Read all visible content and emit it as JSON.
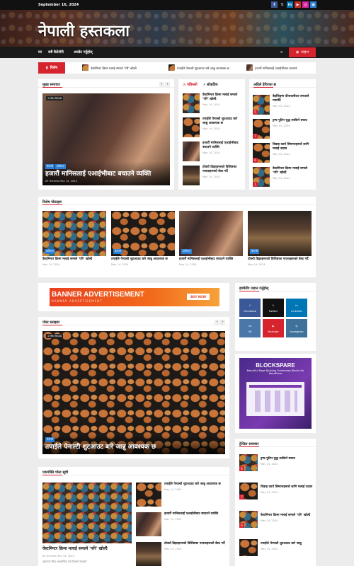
{
  "topbar": {
    "date": "September 16, 2024",
    "social": [
      "f",
      "𝕏",
      "in",
      "▶",
      "◎",
      "▣"
    ]
  },
  "site": {
    "title": "नेपाली हस्तकला"
  },
  "nav": {
    "items": [
      "घर",
      "सबै कैटेगोरी",
      "अपडेट गर्नुहोस्"
    ],
    "live": "लाइभ"
  },
  "ticker": {
    "label": "विशेष",
    "items": [
      "वेस्टमिन्टर क्रिमा मलाई समाले 'परि' खोल्दै",
      "तपाईले पेनाल्टी शुटआउट बारे जान्नु आवश्यक छ",
      "हजारौं मानिसलाई एआईभीबाट बचाउने"
    ]
  },
  "main_news": {
    "heading": "मुख्य समाचार",
    "minread": "1 MIN READ",
    "tags": [
      "कैटेगरी",
      "वाणिज्य"
    ],
    "title": "हजारौं मानिसलाई एआईभीबाट बचाउने व्यक्ति",
    "meta": "AF themes  May 14, 2024"
  },
  "tabs": {
    "a": "पछिल्लो",
    "b": "लोकप्रिय"
  },
  "latest": [
    {
      "title": "वेस्टमिन्टर क्रिमा मलाई समाले 'परि' खोल्दै",
      "date": "May 14, 2024"
    },
    {
      "title": "तपाईले पेनाल्टी शुटआउट बारे जान्नु आवश्यक छ",
      "date": "May 14, 2024"
    },
    {
      "title": "हजारौं मानिसलाई एआईभीबाट बचाउने व्यक्ति",
      "date": "May 14, 2024"
    },
    {
      "title": "टोक्यो डिझाइनरको विशिष्टका नायकहरूको बेल्ट गर्दै",
      "date": "May 14, 2024"
    }
  ],
  "editors": {
    "heading": "अहिले हेरिएका छ",
    "items": [
      {
        "num": "5",
        "title": "बेइजिङ्गमा दीपावलीका जनताले मनाउँदै",
        "date": "May 14, 2024"
      },
      {
        "num": "7",
        "title": "ट्रम्प-पुटिन युद्ध लाकिने बचाउ",
        "date": "May 14, 2024"
      },
      {
        "num": "6",
        "title": "विवाह कार्य सिमानाहरूले लागि मलाई उदास",
        "date": "May 14, 2024"
      },
      {
        "num": "1",
        "title": "वेस्टमिन्टर क्रिमा मलाई समाले 'परि' खोल्दै",
        "date": "May 14, 2024"
      }
    ]
  },
  "special": {
    "heading": "विशेष पोस्टहरू",
    "items": [
      {
        "tag": "वाणिज्य",
        "title": "वेस्टमिन्टर क्रिमा मलाई समाले 'परि' खोल्दै",
        "date": "May 14, 2024"
      },
      {
        "tag": "कैटेगरी",
        "title": "तपाईले पेनाल्टी शुटआउट बारे जान्नु आवश्यक छ",
        "date": "May 14, 2024"
      },
      {
        "tag": "वाणिज्य",
        "title": "हजारौं मानिसलाई एआईभीबाट बचाउने व्यक्ति",
        "date": "May 14, 2024"
      },
      {
        "tag": "कैटेगरी",
        "title": "टोक्यो डिझाइनरको विशिष्टका नायकहरूको बेल्ट गर्दै",
        "date": "May 14, 2024"
      }
    ]
  },
  "banner": {
    "title": "BANNER ADVERTISEMENT",
    "sub": "BANNER ADVERTISEMENT",
    "btn": "BUY NOW"
  },
  "connect": {
    "heading": "हामीसँग जडान गर्नुहोस्",
    "items": [
      "Facebook",
      "Twitter",
      "Linkedin",
      "VK",
      "Youtube",
      "Instagram"
    ]
  },
  "post_slider": {
    "heading": "पोस्ट स्लाइडर",
    "minread": "1 MIN READ",
    "tag": "कैटेगरी",
    "title": "तपाईले पेनाल्टी शुटआउट बारे जान्नु आवश्यक छ"
  },
  "blockspare": {
    "title": "BLOCKSPARE",
    "sub": "Beautiful Page Building Gutenberg Blocks for WordPress"
  },
  "trending": {
    "heading": "ट्रेन्डिङ समाचार",
    "items": [
      {
        "num": "6",
        "title": "ट्रम्प-पुटिन युद्ध लाकिने बचाउ",
        "date": "May 14, 2024"
      },
      {
        "num": "7",
        "title": "विवाह कार्य सिमानाहरूले लागि मलाई उदास",
        "date": "May 14, 2024"
      },
      {
        "num": "6",
        "title": "वेस्टमिन्टर क्रिमा मलाई समाले 'परि' खोल्दै",
        "date": "May 14, 2024"
      },
      {
        "num": "",
        "title": "तपाईले पेनाल्टी शुटआउट बारे जान्नु",
        "date": "May 14, 2024"
      }
    ]
  },
  "single_col": {
    "heading": "एकपंक्ति पोस्ट सूची",
    "main_title": "वेस्टमिन्टर क्रिमा मलाई समाले 'परि' खोल्दै",
    "main_meta": "AF themes  May 14, 2024",
    "main_excerpt": "हस्तकला विद्या आध्यात्मिक एवं दिनचर्या रमाइलो",
    "side": [
      {
        "title": "तपाईले पेनाल्टी शुटआउट बारे जान्नु आवश्यक छ",
        "date": "May 14, 2024"
      },
      {
        "title": "हजारौं मानिसलाई एआईभीबाट बचाउने व्यक्ति",
        "date": "May 14, 2024"
      },
      {
        "title": "टोक्यो डिझाइनरको विशिष्टका नायकहरूको बेल्ट गर्दै",
        "date": "May 14, 2024"
      }
    ]
  },
  "colors": {
    "accent": "#d6242f",
    "tag": "#2a7fd6"
  }
}
